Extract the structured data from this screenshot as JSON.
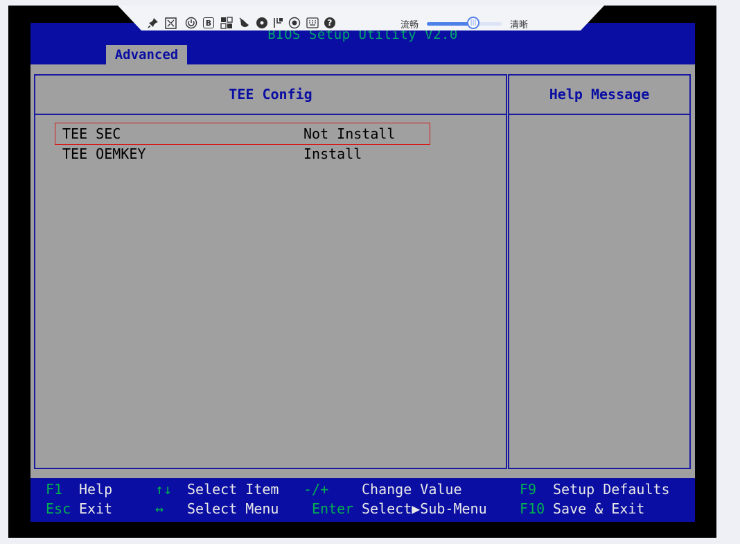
{
  "toolbar": {
    "icons": [
      "pin-icon",
      "fullscreen-icon",
      "power-icon",
      "boot-icon",
      "keyboard-icon",
      "mouse-icon",
      "cd-icon",
      "record-icon",
      "screenshot-icon",
      "soft-keyboard-icon",
      "help-icon"
    ],
    "boot_letter": "B",
    "help_glyph": "?",
    "smooth_label": "流畅",
    "clear_label": "清晰",
    "quality_level": 0.62,
    "accent_color": "#4f7fe8"
  },
  "bios": {
    "title": "BIOS Setup Utility V2.0",
    "tab": "Advanced",
    "panel_title": "TEE Config",
    "help_title": "Help Message",
    "settings": [
      {
        "label": "TEE SEC",
        "value": "Not Install",
        "selected": true
      },
      {
        "label": "TEE OEMKEY",
        "value": "Install",
        "selected": false
      }
    ],
    "footer": {
      "f1_key": "F1",
      "f1_text": "Help",
      "arrows_ud_key": "↑↓",
      "arrows_ud_text": "Select Item",
      "plusminus_key": "-/+",
      "plusminus_text": "Change Value",
      "f9_key": "F9",
      "f9_text": "Setup Defaults",
      "esc_key": "Esc",
      "esc_text": "Exit",
      "arrows_lr_key": "↔",
      "arrows_lr_text": "Select Menu",
      "enter_key": "Enter",
      "enter_text": "Select▶Sub-Menu",
      "f10_key": "F10",
      "f10_text": "Save & Exit"
    },
    "colors": {
      "blue": "#0a0ea2",
      "gray": "#a0a0a0",
      "key_green": "#00b050",
      "selection_red": "#d81a1a"
    }
  }
}
